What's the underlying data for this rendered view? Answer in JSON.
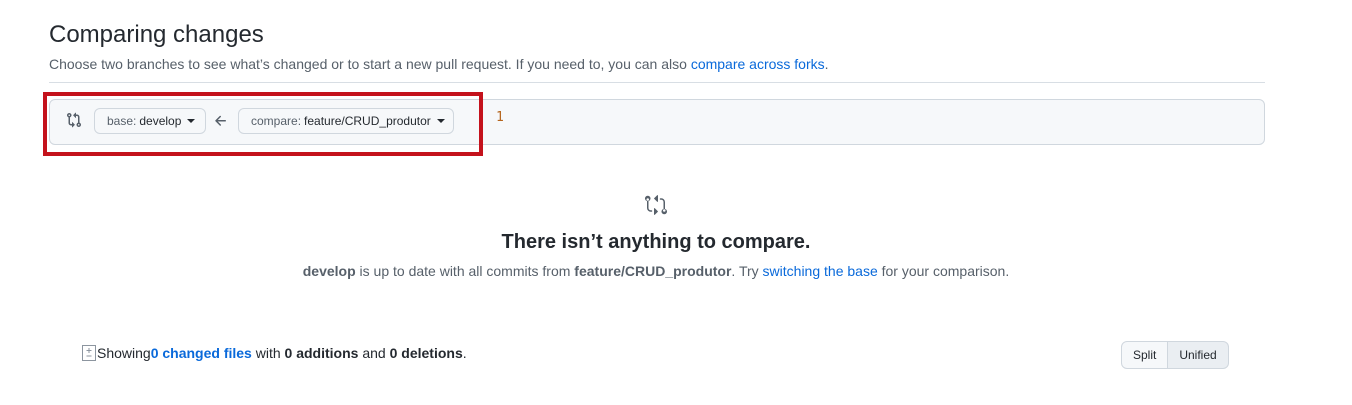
{
  "header": {
    "title": "Comparing changes",
    "subtitle_text": "Choose two branches to see what’s changed or to start a new pull request. If you need to, you can also ",
    "subtitle_link": "compare across forks",
    "subtitle_end": "."
  },
  "range": {
    "base_prefix": "base:",
    "base_branch": "develop",
    "compare_prefix": "compare:",
    "compare_branch": "feature/CRUD_produtor",
    "annotation": "1"
  },
  "blankslate": {
    "title": "There isn’t anything to compare.",
    "base_branch": "develop",
    "text_mid": " is up to date with all commits from ",
    "head_branch": "feature/CRUD_produtor",
    "text_try": ". Try ",
    "link": "switching the base",
    "text_end": " for your comparison."
  },
  "toc": {
    "showing": "Showing ",
    "changed_files": "0 changed files",
    "with": " with ",
    "additions": "0 additions",
    "and": " and ",
    "deletions": "0 deletions",
    "period": "."
  },
  "view_toggle": {
    "split_label": "Split",
    "unified_label": "Unified",
    "selected": "Unified"
  },
  "colors": {
    "link": "#0969da",
    "highlight": "#c4121c"
  }
}
